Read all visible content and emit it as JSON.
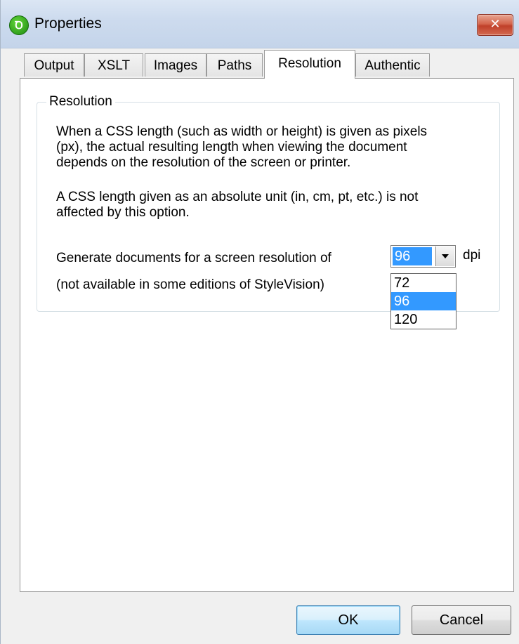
{
  "window": {
    "title": "Properties",
    "app_icon_glyph": "Ꝺ",
    "close_glyph": "✕"
  },
  "tabs": [
    {
      "label": "Output",
      "active": false
    },
    {
      "label": "XSLT",
      "active": false
    },
    {
      "label": "Images",
      "active": false
    },
    {
      "label": "Paths",
      "active": false
    },
    {
      "label": "Resolution",
      "active": true
    },
    {
      "label": "Authentic",
      "active": false
    }
  ],
  "resolution_group": {
    "legend": "Resolution",
    "para1": [
      "When a CSS length (such as width or height) is given as pixels",
      "(px), the actual resulting length when viewing the document",
      "depends on the resolution of the screen or printer."
    ],
    "para2": [
      "A CSS length given as an absolute unit (in, cm, pt, etc.) is not",
      "affected by this option."
    ],
    "generate_label": "Generate documents for a screen resolution of",
    "availability_note": "(not available in some editions of StyleVision)",
    "dpi_value": "96",
    "dpi_unit": "dpi",
    "dpi_options": [
      "72",
      "96",
      "120"
    ],
    "dpi_selected_option": "96"
  },
  "buttons": {
    "ok": "OK",
    "cancel": "Cancel"
  },
  "colors": {
    "selection": "#3399ff",
    "close_button": "#c94b33",
    "titlebar": "#cddbee"
  },
  "icons": {
    "app": "stylevision-icon",
    "close": "close-icon",
    "dropdown": "chevron-down-icon"
  }
}
